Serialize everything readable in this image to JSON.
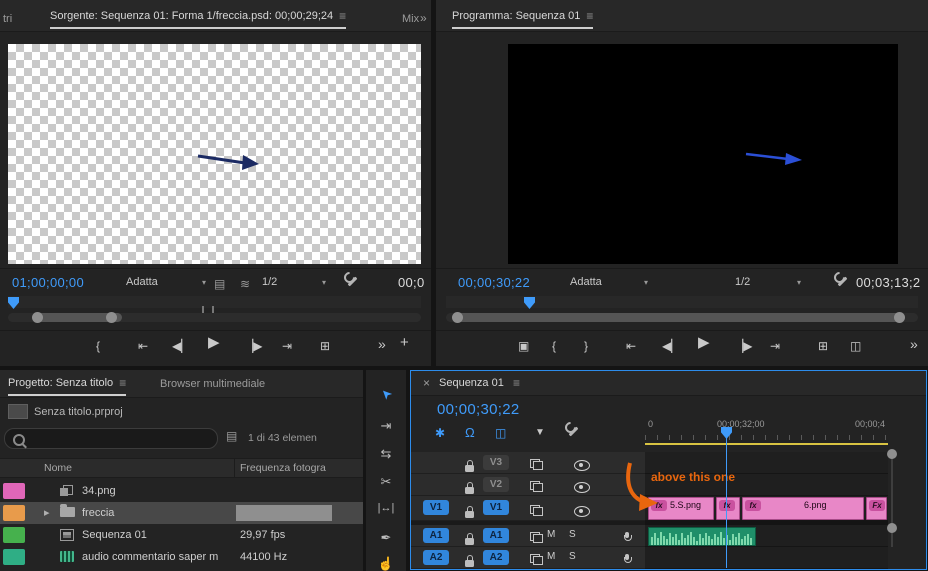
{
  "glyphs": {
    "menu": "≡",
    "chevrons": "»",
    "caret": "▾",
    "close": "×",
    "plus": "+",
    "expander": "▸",
    "drag_video": "▤",
    "drag_audio": "≋",
    "filter": "▤"
  },
  "colors": {
    "accent_blue": "#2d8ceb",
    "timecode_blue": "#3f9bfa",
    "clip_pink": "#e887c7",
    "fx_badge_pink": "#c9519f",
    "audio_clip_green": "#1f8f69",
    "waveform_green": "#7fd9ac",
    "annotation_orange": "#e8660e",
    "render_bar_yellow": "#d8c342",
    "badge_blue": "#3186dc"
  },
  "source_monitor": {
    "tab_overflow_left": "tri",
    "tab_title": "Sorgente: Sequenza 01: Forma 1/freccia.psd: 00;00;29;24",
    "tab_mixer": "Mix",
    "timecode": "01;00;00;00",
    "fit": "Adatta",
    "zoom": "1/2",
    "right_timecode": "00;0",
    "transport": {
      "mark_in": "{",
      "go_to_in": "⇤",
      "step_back": "◀▏",
      "play": "▶",
      "step_forward": "▕▶",
      "go_to_out": "⇥",
      "insert": "⊞"
    }
  },
  "program_monitor": {
    "tab_title": "Programma: Sequenza 01",
    "timecode": "00;00;30;22",
    "fit": "Adatta",
    "zoom": "1/2",
    "right_timecode": "00;03;13;2",
    "transport": {
      "add_marker": "▣",
      "mark_in": "{",
      "mark_out": "}",
      "go_to_in": "⇤",
      "step_back": "◀▏",
      "play": "▶",
      "step_forward": "▕▶",
      "go_to_out": "⇥",
      "export_frame": "⊞",
      "comparison_view": "◫"
    }
  },
  "project_panel": {
    "tab_active": "Progetto: Senza titolo",
    "tab_inactive": "Browser multimediale",
    "project_name": "Senza titolo.prproj",
    "item_count": "1 di 43 elemen",
    "columns": {
      "name": "Nome",
      "frame_rate": "Frequenza fotogra"
    },
    "rows": [
      {
        "label": "34.png",
        "frame_rate": "",
        "chip_color": "#e066b8"
      },
      {
        "label": "freccia",
        "frame_rate": "",
        "chip_color": "#e89b4b"
      },
      {
        "label": "Sequenza 01",
        "frame_rate": "29,97 fps",
        "chip_color": "#46b14d"
      },
      {
        "label": "audio commentario saper m",
        "frame_rate": "44100 Hz",
        "chip_color": "#2fae85"
      }
    ]
  },
  "tools": [
    {
      "name": "selection",
      "glyph": "➤"
    },
    {
      "name": "track-select-forward",
      "glyph": "⇥"
    },
    {
      "name": "ripple-edit",
      "glyph": "⇆"
    },
    {
      "name": "razor",
      "glyph": "✂"
    },
    {
      "name": "slip",
      "glyph": "|↔|"
    },
    {
      "name": "pen",
      "glyph": "✒"
    },
    {
      "name": "hand",
      "glyph": "☝"
    }
  ],
  "timeline": {
    "tab_title": "Sequenza 01",
    "timecode": "00;00;30;22",
    "toolbar": {
      "nest": "✱",
      "snap": "Ω",
      "linked_selection": "◫",
      "add_marker": "▼"
    },
    "ruler_labels": [
      "0",
      "00;00;32;00",
      "00;00;4"
    ],
    "video_tracks": [
      {
        "name": "V3",
        "source": ""
      },
      {
        "name": "V2",
        "source": ""
      },
      {
        "name": "V1",
        "source": "V1"
      }
    ],
    "audio_tracks": [
      {
        "name": "A1",
        "source": "A1",
        "mute": "M",
        "solo": "S"
      },
      {
        "name": "A2",
        "source": "A2",
        "mute": "M",
        "solo": "S"
      }
    ],
    "clips": [
      {
        "fx": "fx",
        "label": "5.S.png"
      },
      {
        "fx": "fx",
        "label": ""
      },
      {
        "fx": "fx",
        "label": "6.png"
      },
      {
        "fx": "Fx",
        "label": ""
      }
    ],
    "annotation": "above this one"
  }
}
